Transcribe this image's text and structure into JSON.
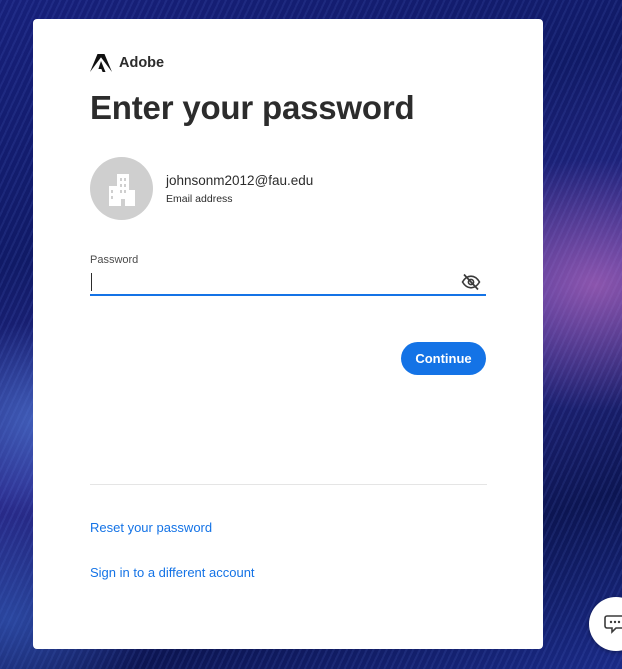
{
  "brand": {
    "name": "Adobe",
    "logo_icon": "adobe-logo"
  },
  "heading": "Enter your password",
  "account": {
    "avatar_icon": "building-icon",
    "email": "johnsonm2012@fau.edu",
    "email_label": "Email address"
  },
  "password": {
    "label": "Password",
    "value": "",
    "toggle_icon": "eye-slash-icon"
  },
  "actions": {
    "continue_label": "Continue"
  },
  "links": {
    "reset": "Reset your password",
    "different_account": "Sign in to a different account"
  },
  "chat_widget": {
    "icon": "chat-bubble-icon"
  },
  "colors": {
    "accent": "#1473e6",
    "text": "#2c2c2c",
    "avatar_bg": "#cfcfcf",
    "card_bg": "#ffffff"
  }
}
